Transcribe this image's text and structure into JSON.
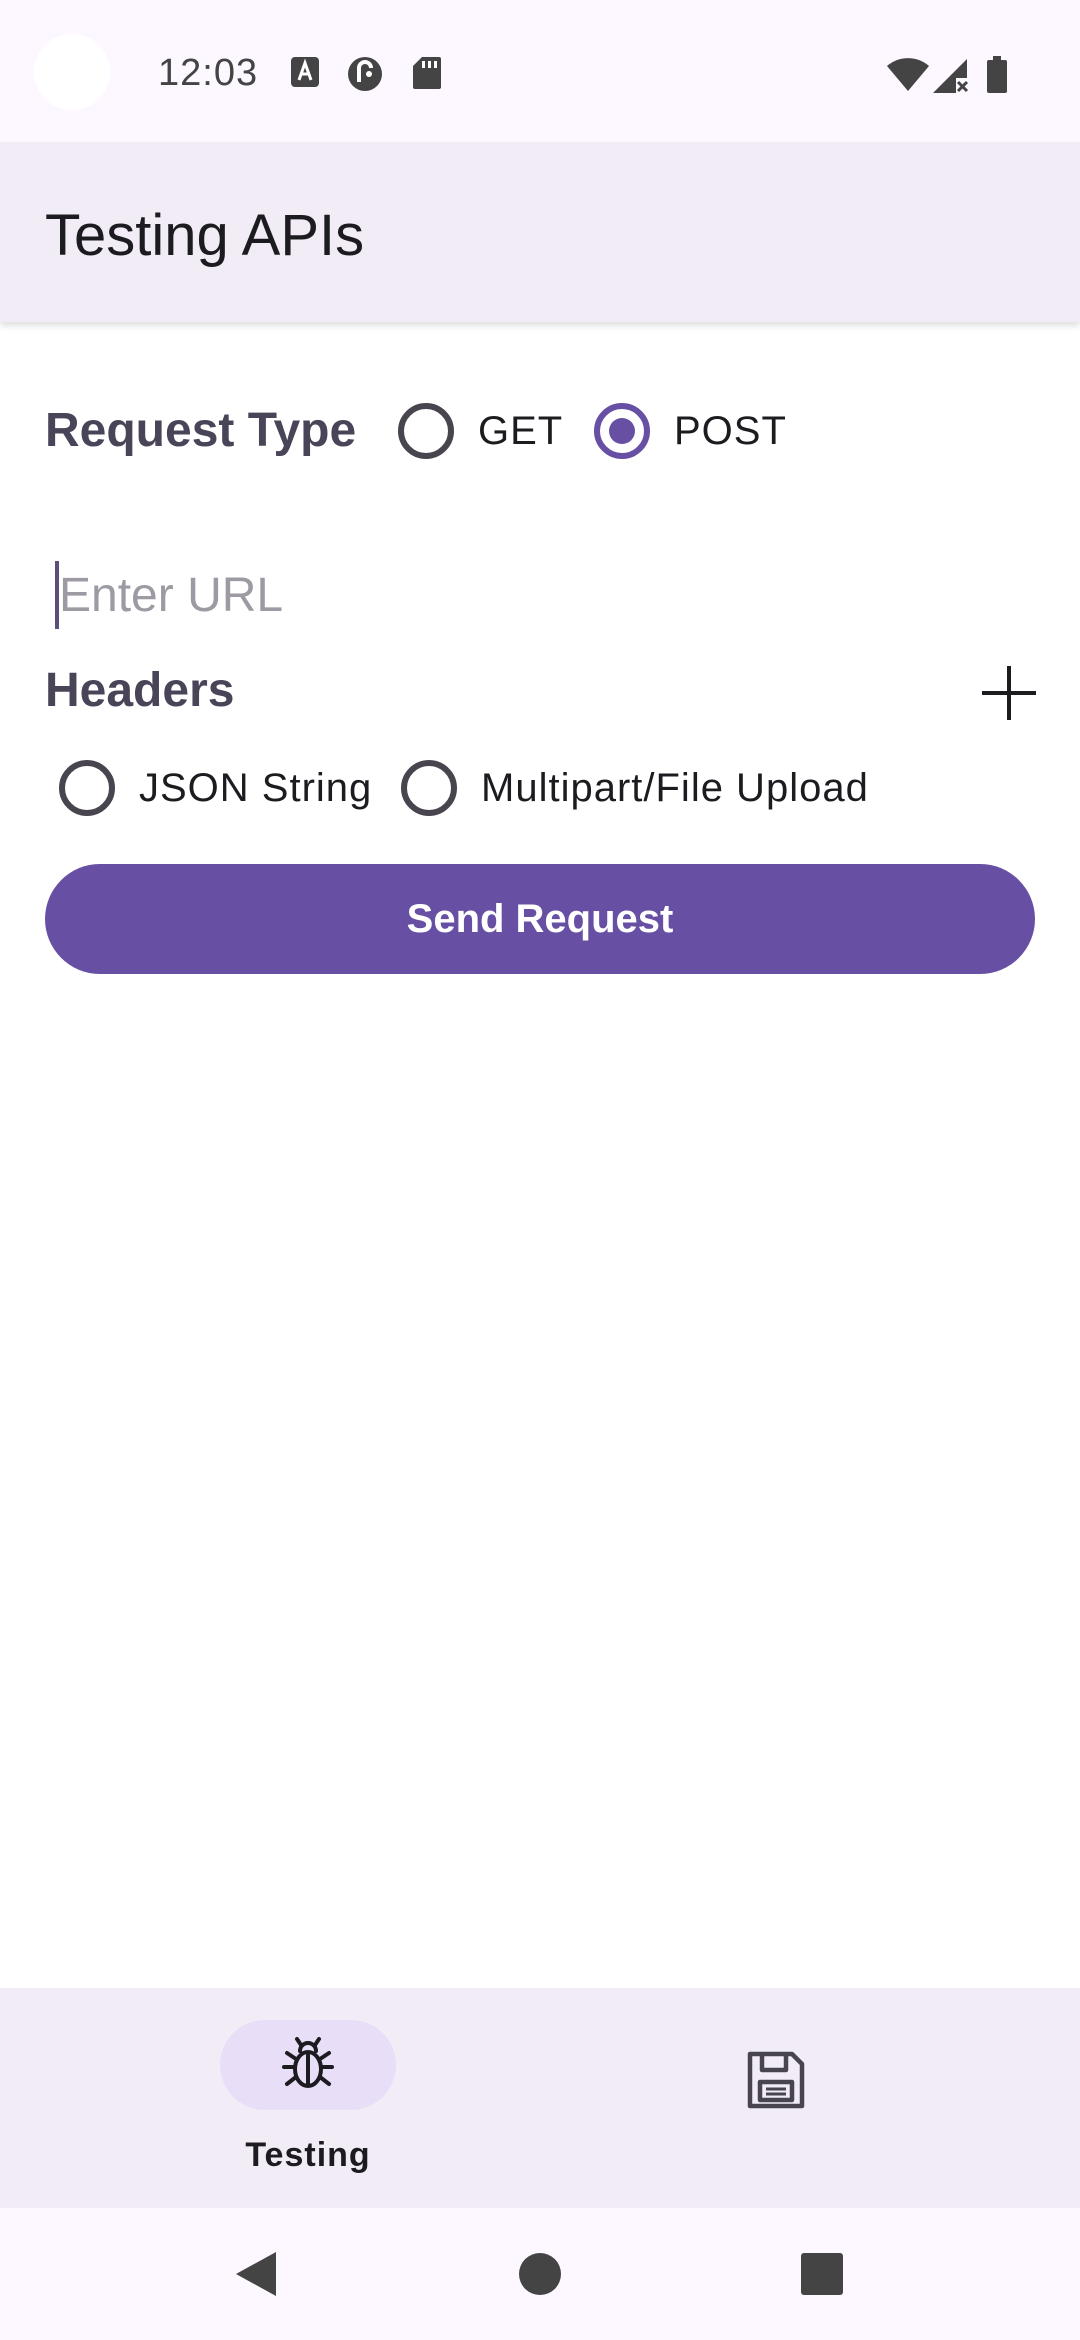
{
  "status_bar": {
    "time": "12:03",
    "left_icons": [
      "a-notification-icon",
      "pocket-casts-icon",
      "sd-card-icon"
    ],
    "right_icons": [
      "wifi-icon",
      "signal-no-service-icon",
      "battery-icon"
    ]
  },
  "app_bar": {
    "title": "Testing APIs"
  },
  "request_type": {
    "label": "Request Type",
    "options": [
      {
        "label": "GET",
        "selected": false
      },
      {
        "label": "POST",
        "selected": true
      }
    ]
  },
  "url_input": {
    "placeholder": "Enter URL",
    "value": ""
  },
  "headers": {
    "label": "Headers",
    "add_icon": "plus-icon"
  },
  "body_type": {
    "options": [
      {
        "label": "JSON String",
        "selected": false
      },
      {
        "label": "Multipart/File Upload",
        "selected": false
      }
    ]
  },
  "send_button": {
    "label": "Send Request"
  },
  "bottom_nav": {
    "items": [
      {
        "label": "Testing",
        "icon": "bug-icon",
        "selected": true
      },
      {
        "label": "",
        "icon": "save-icon",
        "selected": false
      }
    ]
  },
  "system_nav": {
    "buttons": [
      "back-icon",
      "home-icon",
      "recents-icon"
    ]
  },
  "colors": {
    "primary": "#6750a4",
    "app_bar_bg": "#f2ecf6",
    "nav_indicator": "#e8def8"
  }
}
